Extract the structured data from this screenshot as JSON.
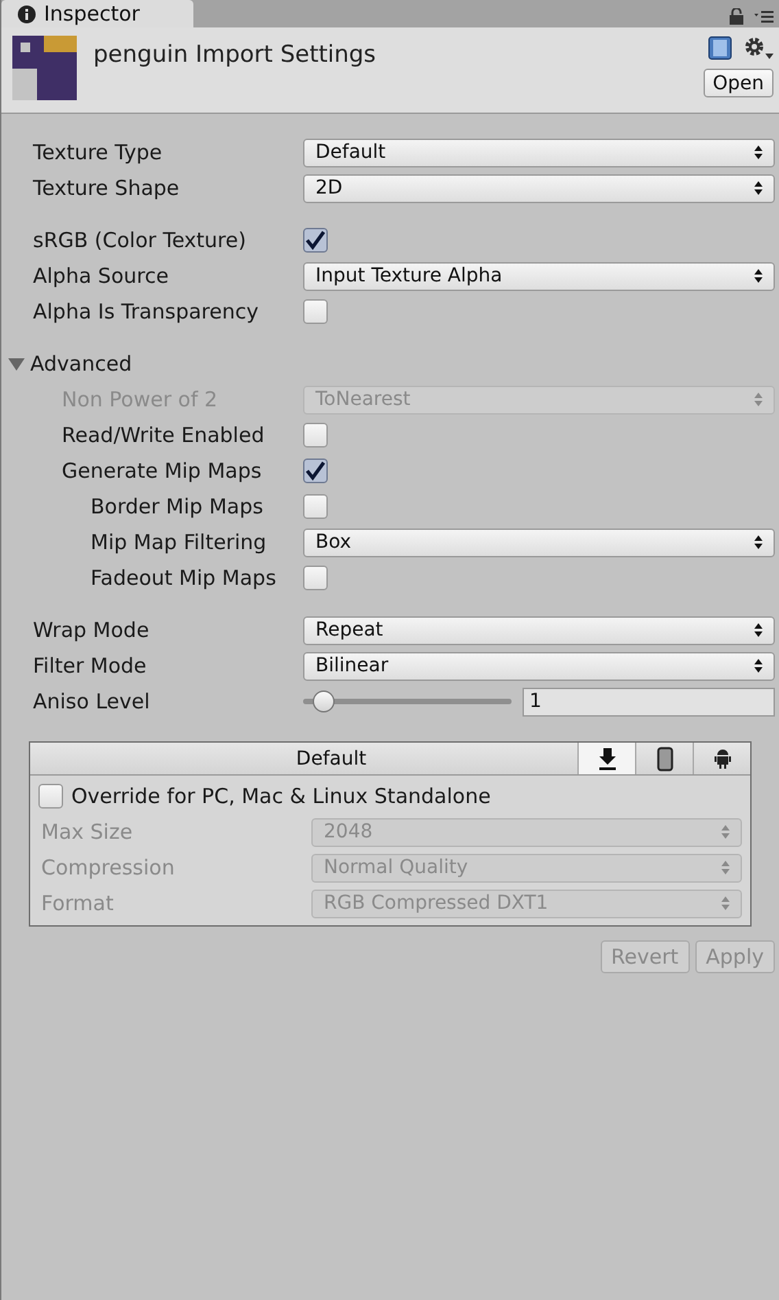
{
  "tab": {
    "label": "Inspector",
    "selected": true
  },
  "header": {
    "title": "penguin Import Settings",
    "open_button": "Open"
  },
  "groups": [
    [
      {
        "kind": "dropdown",
        "label": "Texture Type",
        "value": "Default",
        "disabled": false
      },
      {
        "kind": "dropdown",
        "label": "Texture Shape",
        "value": "2D",
        "disabled": false
      }
    ],
    [
      {
        "kind": "checkbox",
        "label": "sRGB (Color Texture)",
        "checked": true,
        "disabled": false
      },
      {
        "kind": "dropdown",
        "label": "Alpha Source",
        "value": "Input Texture Alpha",
        "disabled": false
      },
      {
        "kind": "checkbox",
        "label": "Alpha Is Transparency",
        "checked": false,
        "disabled": false
      }
    ],
    [
      {
        "kind": "foldout",
        "label": "Advanced",
        "expanded": true,
        "disabled": false,
        "children": [
          {
            "kind": "dropdown",
            "label": "Non Power of 2",
            "value": "ToNearest",
            "disabled": true
          },
          {
            "kind": "checkbox",
            "label": "Read/Write Enabled",
            "checked": false,
            "disabled": false
          },
          {
            "kind": "checkbox",
            "label": "Generate Mip Maps",
            "checked": true,
            "disabled": false,
            "children": [
              {
                "kind": "checkbox",
                "label": "Border Mip Maps",
                "checked": false,
                "disabled": false
              },
              {
                "kind": "dropdown",
                "label": "Mip Map Filtering",
                "value": "Box",
                "disabled": false
              },
              {
                "kind": "checkbox",
                "label": "Fadeout Mip Maps",
                "checked": false,
                "disabled": false
              }
            ]
          }
        ]
      }
    ],
    [
      {
        "kind": "dropdown",
        "label": "Wrap Mode",
        "value": "Repeat",
        "disabled": false
      },
      {
        "kind": "dropdown",
        "label": "Filter Mode",
        "value": "Bilinear",
        "disabled": false
      },
      {
        "kind": "slider",
        "label": "Aniso Level",
        "level": 0.05,
        "value": "1",
        "disabled": false
      }
    ]
  ],
  "platform_panel": {
    "title": "Default",
    "tabs": [
      {
        "kind": "download",
        "selected": true
      },
      {
        "kind": "phone",
        "selected": false
      },
      {
        "kind": "android",
        "selected": false
      }
    ],
    "override": {
      "label": "Override for PC, Mac & Linux Standalone",
      "checked": false
    },
    "fields": [
      {
        "label": "Max Size",
        "value": "2048",
        "disabled": true
      },
      {
        "label": "Compression",
        "value": "Normal Quality",
        "disabled": true
      },
      {
        "label": "Format",
        "value": "RGB Compressed DXT1",
        "disabled": true
      }
    ]
  },
  "buttons": [
    {
      "label": "Revert",
      "disabled": true
    },
    {
      "label": "Apply",
      "disabled": true
    }
  ]
}
